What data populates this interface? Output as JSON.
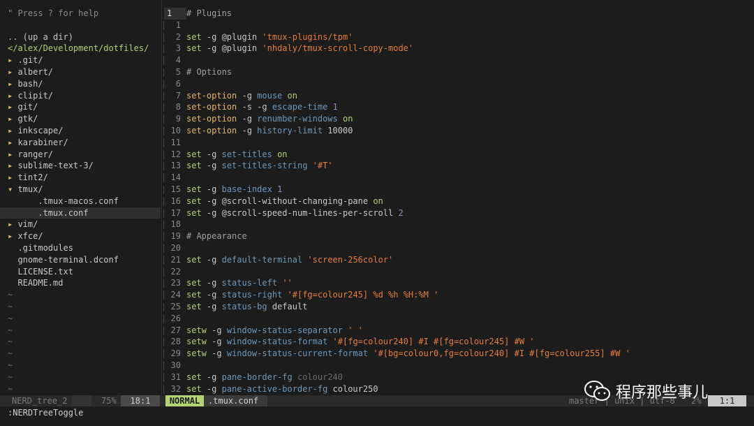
{
  "tree": {
    "help": "\" Press ? for help",
    "updir": ".. (up a dir)",
    "cwd": "</alex/Development/dotfiles/",
    "items": [
      {
        "name": ".git/",
        "kind": "dir-closed",
        "indent": 0
      },
      {
        "name": "albert/",
        "kind": "dir-closed",
        "indent": 0
      },
      {
        "name": "bash/",
        "kind": "dir-closed",
        "indent": 0
      },
      {
        "name": "clipit/",
        "kind": "dir-closed",
        "indent": 0
      },
      {
        "name": "git/",
        "kind": "dir-closed",
        "indent": 0
      },
      {
        "name": "gtk/",
        "kind": "dir-closed",
        "indent": 0
      },
      {
        "name": "inkscape/",
        "kind": "dir-closed",
        "indent": 0
      },
      {
        "name": "karabiner/",
        "kind": "dir-closed",
        "indent": 0
      },
      {
        "name": "ranger/",
        "kind": "dir-closed",
        "indent": 0
      },
      {
        "name": "sublime-text-3/",
        "kind": "dir-closed",
        "indent": 0
      },
      {
        "name": "tint2/",
        "kind": "dir-closed",
        "indent": 0
      },
      {
        "name": "tmux/",
        "kind": "dir-open",
        "indent": 0
      },
      {
        "name": ".tmux-macos.conf",
        "kind": "file",
        "indent": 1
      },
      {
        "name": ".tmux.conf",
        "kind": "file",
        "indent": 1,
        "selected": true
      },
      {
        "name": "vim/",
        "kind": "dir-closed",
        "indent": 0
      },
      {
        "name": "xfce/",
        "kind": "dir-closed",
        "indent": 0
      },
      {
        "name": ".gitmodules",
        "kind": "file",
        "indent": 0
      },
      {
        "name": "gnome-terminal.dconf",
        "kind": "file",
        "indent": 0
      },
      {
        "name": "LICENSE.txt",
        "kind": "file",
        "indent": 0
      },
      {
        "name": "README.md",
        "kind": "file",
        "indent": 0
      }
    ],
    "tilde_count": 9,
    "tilde": "~"
  },
  "editor": {
    "lines": [
      {
        "n": "1",
        "t": [
          [
            "c",
            "# Plugins"
          ]
        ]
      },
      {
        "n": "1",
        "t": []
      },
      {
        "n": "2",
        "t": [
          [
            "k",
            "set"
          ],
          [
            "o",
            " -g @plugin "
          ],
          [
            "s",
            "'tmux-plugins/tpm'"
          ]
        ]
      },
      {
        "n": "3",
        "t": [
          [
            "k",
            "set"
          ],
          [
            "o",
            " -g @plugin "
          ],
          [
            "s",
            "'nhdaly/tmux-scroll-copy-mode'"
          ]
        ]
      },
      {
        "n": "4",
        "t": []
      },
      {
        "n": "5",
        "t": [
          [
            "c",
            "# Options"
          ]
        ]
      },
      {
        "n": "6",
        "t": []
      },
      {
        "n": "7",
        "t": [
          [
            "y",
            "set-option"
          ],
          [
            "o",
            " -g "
          ],
          [
            "p",
            "mouse"
          ],
          [
            "o",
            " "
          ],
          [
            "k",
            "on"
          ]
        ]
      },
      {
        "n": "8",
        "t": [
          [
            "y",
            "set-option"
          ],
          [
            "o",
            " -s -g "
          ],
          [
            "p",
            "escape-time"
          ],
          [
            "o",
            " "
          ],
          [
            "n",
            "1"
          ]
        ]
      },
      {
        "n": "9",
        "t": [
          [
            "y",
            "set-option"
          ],
          [
            "o",
            " -g "
          ],
          [
            "p",
            "renumber-windows"
          ],
          [
            "o",
            " "
          ],
          [
            "k",
            "on"
          ]
        ]
      },
      {
        "n": "10",
        "t": [
          [
            "y",
            "set-option"
          ],
          [
            "o",
            " -g "
          ],
          [
            "p",
            "history-limit"
          ],
          [
            "o",
            " 10000"
          ]
        ]
      },
      {
        "n": "11",
        "t": []
      },
      {
        "n": "12",
        "t": [
          [
            "k",
            "set"
          ],
          [
            "o",
            " -g "
          ],
          [
            "p",
            "set-titles"
          ],
          [
            "o",
            " "
          ],
          [
            "k",
            "on"
          ]
        ]
      },
      {
        "n": "13",
        "t": [
          [
            "k",
            "set"
          ],
          [
            "o",
            " -g "
          ],
          [
            "p",
            "set-titles-string"
          ],
          [
            "o",
            " "
          ],
          [
            "s",
            "'#T'"
          ]
        ]
      },
      {
        "n": "14",
        "t": []
      },
      {
        "n": "15",
        "t": [
          [
            "k",
            "set"
          ],
          [
            "o",
            " -g "
          ],
          [
            "p",
            "base-index"
          ],
          [
            "o",
            " "
          ],
          [
            "n",
            "1"
          ]
        ]
      },
      {
        "n": "16",
        "t": [
          [
            "k",
            "set"
          ],
          [
            "o",
            " -g @scroll-without-changing-pane "
          ],
          [
            "k",
            "on"
          ]
        ]
      },
      {
        "n": "17",
        "t": [
          [
            "k",
            "set"
          ],
          [
            "o",
            " -g @scroll-speed-num-lines-per-scroll "
          ],
          [
            "n",
            "2"
          ]
        ]
      },
      {
        "n": "18",
        "t": []
      },
      {
        "n": "19",
        "t": [
          [
            "c",
            "# Appearance"
          ]
        ]
      },
      {
        "n": "20",
        "t": []
      },
      {
        "n": "21",
        "t": [
          [
            "k",
            "set"
          ],
          [
            "o",
            " -g "
          ],
          [
            "p",
            "default-terminal"
          ],
          [
            "o",
            " "
          ],
          [
            "s",
            "'screen-256color'"
          ]
        ]
      },
      {
        "n": "22",
        "t": []
      },
      {
        "n": "23",
        "t": [
          [
            "k",
            "set"
          ],
          [
            "o",
            " -g "
          ],
          [
            "p",
            "status-left"
          ],
          [
            "o",
            " "
          ],
          [
            "s",
            "''"
          ]
        ]
      },
      {
        "n": "24",
        "t": [
          [
            "k",
            "set"
          ],
          [
            "o",
            " -g "
          ],
          [
            "p",
            "status-right"
          ],
          [
            "o",
            " "
          ],
          [
            "s",
            "'#[fg=colour245] %d %h %H:%M '"
          ]
        ]
      },
      {
        "n": "25",
        "t": [
          [
            "k",
            "set"
          ],
          [
            "o",
            " -g "
          ],
          [
            "p",
            "status-bg"
          ],
          [
            "o",
            " default"
          ]
        ]
      },
      {
        "n": "26",
        "t": []
      },
      {
        "n": "27",
        "t": [
          [
            "k",
            "setw"
          ],
          [
            "o",
            " -g "
          ],
          [
            "p",
            "window-status-separator"
          ],
          [
            "o",
            " "
          ],
          [
            "s",
            "' '"
          ]
        ]
      },
      {
        "n": "28",
        "t": [
          [
            "k",
            "setw"
          ],
          [
            "o",
            " -g "
          ],
          [
            "p",
            "window-status-format"
          ],
          [
            "o",
            " "
          ],
          [
            "s",
            "'#[fg=colour240] #I #[fg=colour245] #W '"
          ]
        ]
      },
      {
        "n": "29",
        "t": [
          [
            "k",
            "setw"
          ],
          [
            "o",
            " -g "
          ],
          [
            "p",
            "window-status-current-format"
          ],
          [
            "o",
            " "
          ],
          [
            "s",
            "'#[bg=colour0,fg=colour240] #I #[fg=colour255] #W '"
          ]
        ]
      },
      {
        "n": "30",
        "t": []
      },
      {
        "n": "31",
        "t": [
          [
            "k",
            "set"
          ],
          [
            "o",
            " -g "
          ],
          [
            "p",
            "pane-border-fg"
          ],
          [
            "o",
            " "
          ],
          [
            "d",
            "colour240"
          ]
        ]
      },
      {
        "n": "32",
        "t": [
          [
            "k",
            "set"
          ],
          [
            "o",
            " -g "
          ],
          [
            "p",
            "pane-active-border-fg"
          ],
          [
            "o",
            " colour250"
          ]
        ]
      }
    ]
  },
  "status": {
    "tree_name": "NERD_tree_2",
    "tree_pct": "75%",
    "tree_pos": "18:1",
    "mode": "NORMAL",
    "filename": ".tmux.conf",
    "right": "master | unix | utf-8",
    "pct": "2%",
    "pos": "1:1"
  },
  "cmdline": ":NERDTreeToggle",
  "watermark": "程序那些事儿",
  "colors": {
    "mode_bg": "#b4d273",
    "mode_fg": "#1c1c1c",
    "bg": "#1c1c1c"
  }
}
